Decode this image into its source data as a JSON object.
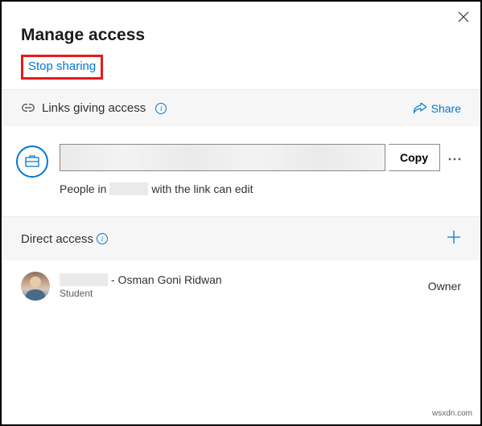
{
  "dialog": {
    "title": "Manage access",
    "stop_sharing_label": "Stop sharing"
  },
  "links_section": {
    "title": "Links giving access",
    "share_label": "Share",
    "copy_label": "Copy",
    "link_value": "",
    "description_prefix": "People in",
    "description_suffix": "with the link can edit"
  },
  "direct_section": {
    "title": "Direct access"
  },
  "people": [
    {
      "name_suffix": "- Osman Goni Ridwan",
      "role": "Student",
      "permission": "Owner"
    }
  ],
  "watermark": "wsxdn.com"
}
